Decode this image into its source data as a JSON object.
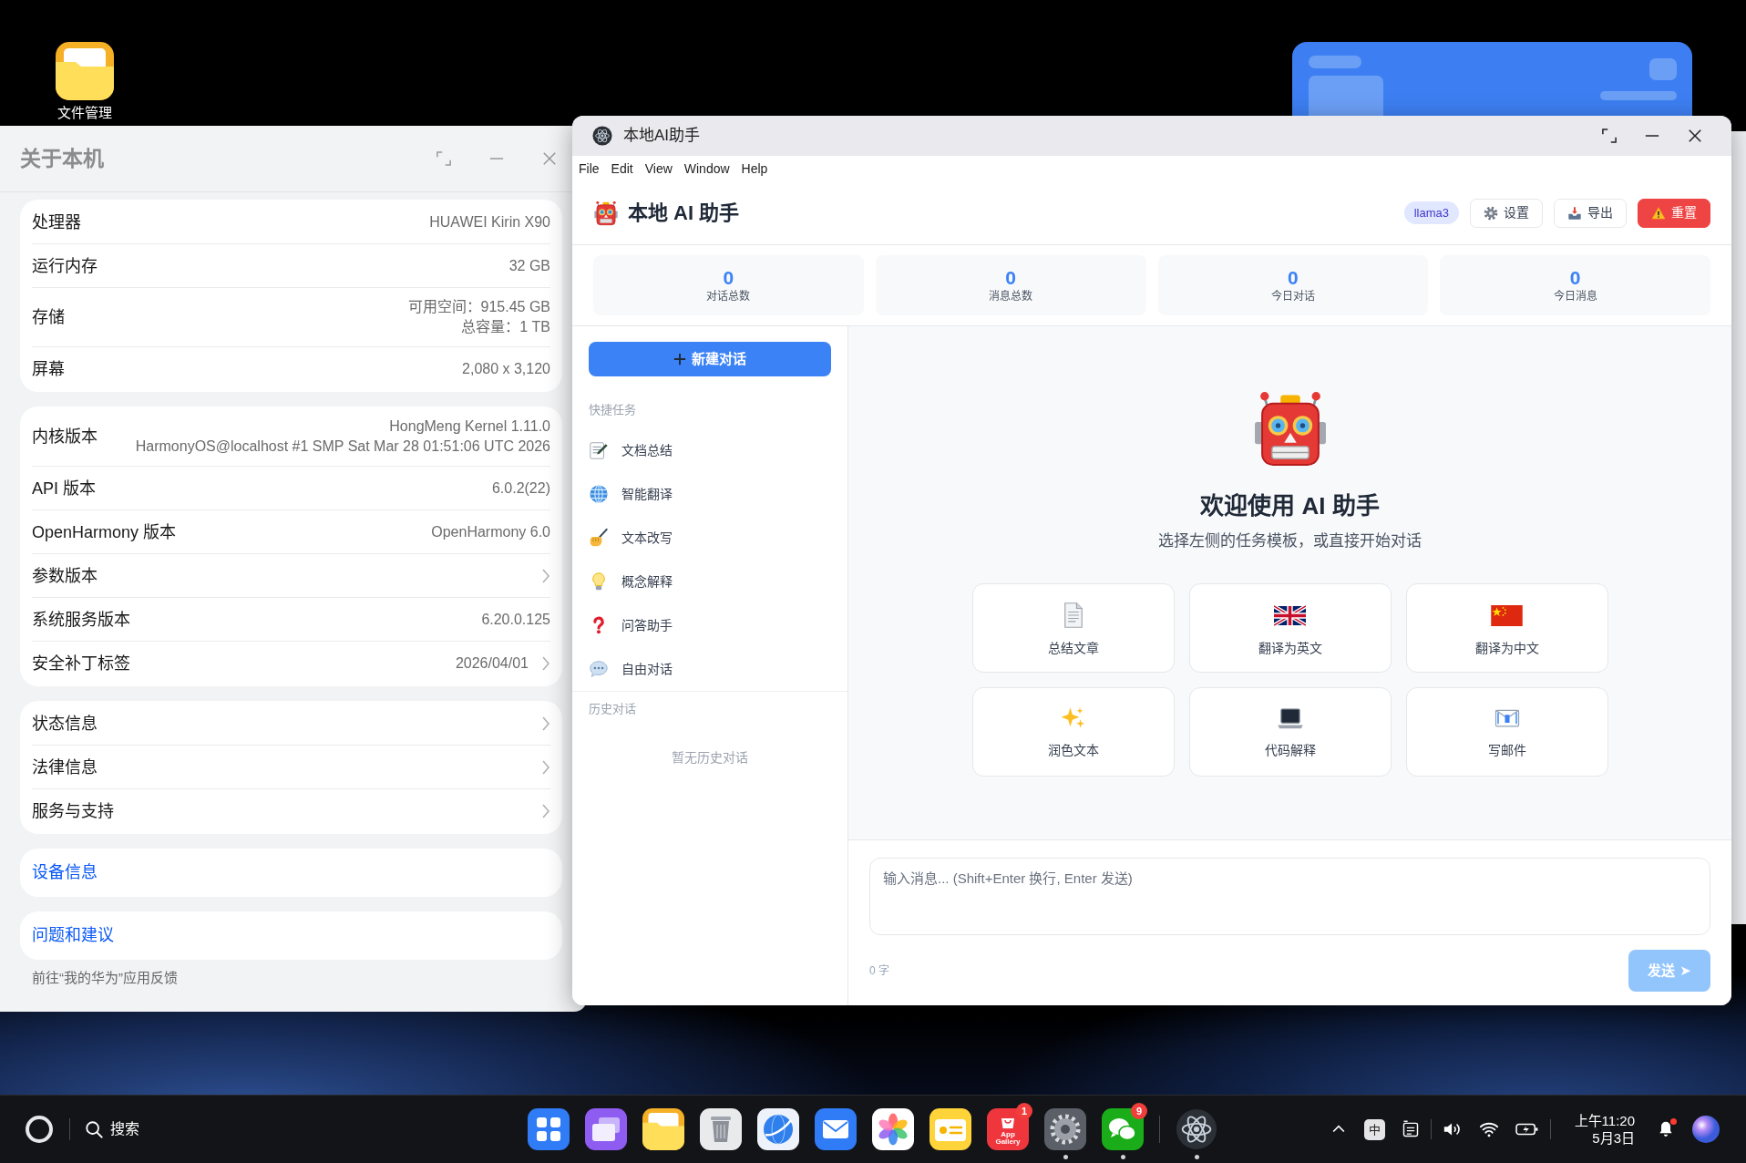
{
  "desktop_icons": [
    {
      "label": "文件管理"
    }
  ],
  "about_window": {
    "title": "关于本机",
    "focused": false,
    "groups": [
      {
        "rows": [
          {
            "label": "处理器",
            "value_lines": [
              "HUAWEI Kirin X90"
            ],
            "chevron": false
          },
          {
            "label": "运行内存",
            "value_lines": [
              "32 GB"
            ],
            "chevron": false
          },
          {
            "label": "存储",
            "value_lines": [
              "可用空间：915.45 GB",
              "总容量：1 TB"
            ],
            "chevron": false
          },
          {
            "label": "屏幕",
            "value_lines": [
              "2,080 x 3,120"
            ],
            "chevron": false
          }
        ]
      },
      {
        "rows": [
          {
            "label": "内核版本",
            "value_lines": [
              "HongMeng Kernel 1.11.0",
              "HarmonyOS@localhost #1 SMP Sat Mar 28 01:51:06 UTC 2026"
            ],
            "chevron": false
          },
          {
            "label": "API 版本",
            "value_lines": [
              "6.0.2(22)"
            ],
            "chevron": false
          },
          {
            "label": "OpenHarmony 版本",
            "value_lines": [
              "OpenHarmony 6.0"
            ],
            "chevron": false
          },
          {
            "label": "参数版本",
            "chevron": true
          },
          {
            "label": "系统服务版本",
            "value_lines": [
              "6.20.0.125"
            ],
            "chevron": false
          },
          {
            "label": "安全补丁标签",
            "value_lines": [
              "2026/04/01"
            ],
            "chevron": true
          }
        ]
      },
      {
        "rows": [
          {
            "label": "状态信息",
            "chevron": true
          },
          {
            "label": "法律信息",
            "chevron": true
          },
          {
            "label": "服务与支持",
            "chevron": true
          }
        ]
      }
    ],
    "links": [
      "设备信息",
      "问题和建议"
    ],
    "footnote": "前往“我的华为”应用反馈"
  },
  "ai_window": {
    "title": "本地AI助手",
    "focused": true,
    "menu": [
      "File",
      "Edit",
      "View",
      "Window",
      "Help"
    ],
    "header": {
      "title": "本地 AI 助手",
      "model": "llama3",
      "buttons": [
        {
          "kind": "settings",
          "label": "设置"
        },
        {
          "kind": "export",
          "label": "导出"
        },
        {
          "kind": "reset",
          "label": "重置"
        }
      ]
    },
    "stats": [
      {
        "value": "0",
        "label": "对话总数"
      },
      {
        "value": "0",
        "label": "消息总数"
      },
      {
        "value": "0",
        "label": "今日对话"
      },
      {
        "value": "0",
        "label": "今日消息"
      }
    ],
    "sidebar": {
      "new_chat": "新建对话",
      "quick_title": "快捷任务",
      "tasks": [
        {
          "kind": "summary",
          "label": "文档总结"
        },
        {
          "kind": "translate",
          "label": "智能翻译"
        },
        {
          "kind": "rewrite",
          "label": "文本改写"
        },
        {
          "kind": "explain",
          "label": "概念解释"
        },
        {
          "kind": "qa",
          "label": "问答助手"
        },
        {
          "kind": "chat",
          "label": "自由对话"
        }
      ],
      "history_title": "历史对话",
      "history_empty": "暂无历史对话"
    },
    "welcome": {
      "title": "欢迎使用 AI 助手",
      "subtitle": "选择左侧的任务模板，或直接开始对话",
      "templates": [
        {
          "kind": "summarize",
          "label": "总结文章"
        },
        {
          "kind": "to_english",
          "label": "翻译为英文"
        },
        {
          "kind": "to_chinese",
          "label": "翻译为中文"
        },
        {
          "kind": "polish",
          "label": "润色文本"
        },
        {
          "kind": "code",
          "label": "代码解释"
        },
        {
          "kind": "email",
          "label": "写邮件"
        }
      ]
    },
    "composer": {
      "placeholder": "输入消息... (Shift+Enter 换行, Enter 发送)",
      "char_count": "0 字",
      "send": {
        "label": "发送 ➤",
        "disabled": true
      }
    }
  },
  "taskbar": {
    "search_label": "搜索",
    "apps": [
      {
        "kind": "launcher",
        "running": false
      },
      {
        "kind": "multitask",
        "running": false
      },
      {
        "kind": "files",
        "running": false
      },
      {
        "kind": "trash",
        "running": false
      },
      {
        "kind": "browser",
        "running": false
      },
      {
        "kind": "mail",
        "running": false
      },
      {
        "kind": "photos",
        "running": false
      },
      {
        "kind": "notes",
        "running": false
      },
      {
        "kind": "appstore",
        "running": false,
        "tile_text": "App Gallery",
        "badge": "1"
      },
      {
        "kind": "settings",
        "running": true
      },
      {
        "kind": "chat",
        "running": true,
        "badge": "9"
      }
    ],
    "open_apps": [
      {
        "kind": "assistant",
        "running": true
      }
    ],
    "tray": {
      "input_method": "中",
      "clock_time": "上午11:20",
      "clock_date": "5月3日",
      "unread_notifications": true
    }
  }
}
